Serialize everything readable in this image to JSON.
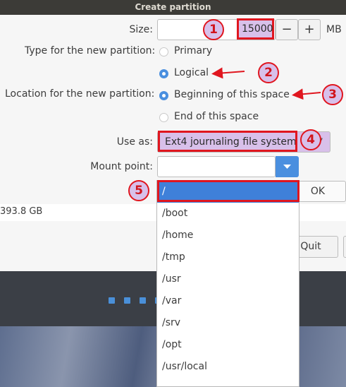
{
  "window": {
    "title": "Create partition"
  },
  "size": {
    "label": "Size:",
    "value": "15000",
    "decrement": "−",
    "increment": "+",
    "unit": "MB"
  },
  "type": {
    "label": "Type for the new partition:",
    "options": [
      "Primary",
      "Logical"
    ],
    "selected": "Logical"
  },
  "location": {
    "label": "Location for the new partition:",
    "options": [
      "Beginning of this space",
      "End of this space"
    ],
    "selected": "Beginning of this space"
  },
  "use_as": {
    "label": "Use as:",
    "value": "Ext4 journaling file system"
  },
  "mount_point": {
    "label": "Mount point:",
    "value": "",
    "options": [
      "/",
      "/boot",
      "/home",
      "/tmp",
      "/usr",
      "/var",
      "/srv",
      "/opt",
      "/usr/local"
    ],
    "selected": "/"
  },
  "buttons": {
    "ok": "OK",
    "quit": "Quit"
  },
  "background": {
    "disk_size": "393.8 GB"
  },
  "annotations": [
    "1",
    "2",
    "3",
    "4",
    "5"
  ],
  "colors": {
    "annotation_red": "#e0161f",
    "accent_blue": "#4a8fdf",
    "badge_fill": "#d8c0ea"
  }
}
